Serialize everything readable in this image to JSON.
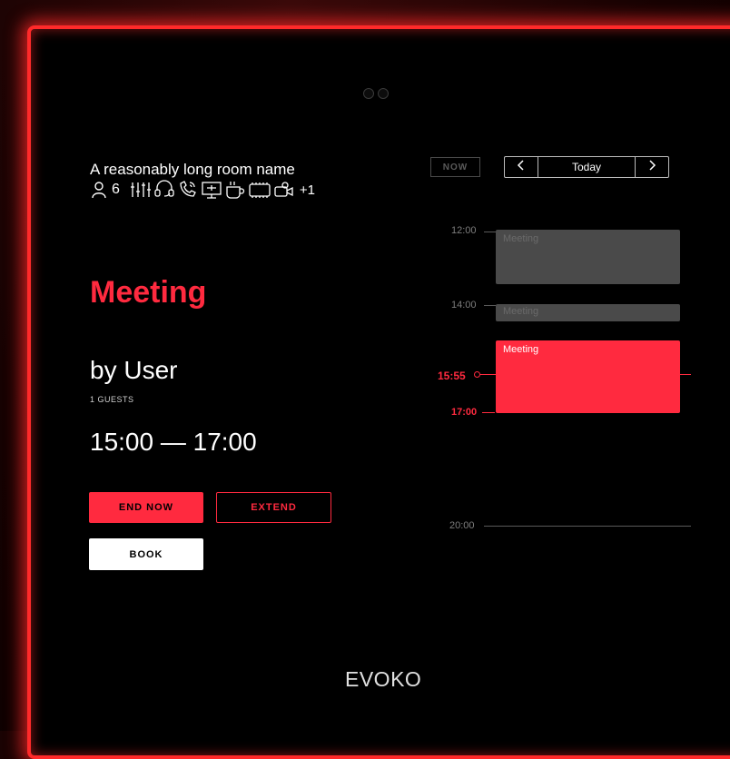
{
  "room": {
    "name": "A reasonably long room name",
    "capacity": "6",
    "more_amenities": "+1",
    "amenity_icons": [
      "person-icon",
      "audio-mixer-icon",
      "headset-icon",
      "phone-icon",
      "display-icon",
      "coffee-icon",
      "projector-icon",
      "video-conference-icon"
    ]
  },
  "meeting": {
    "title": "Meeting",
    "organizer": "by User",
    "guests": "1 GUESTS",
    "time_range": "15:00 — 17:00"
  },
  "actions": {
    "end_now": "END NOW",
    "extend": "EXTEND",
    "book": "BOOK"
  },
  "calendar": {
    "now_button": "NOW",
    "day_label": "Today",
    "hours": [
      "12:00",
      "14:00",
      "20:00"
    ],
    "current_time": "15:55",
    "current_end": "17:00",
    "events": [
      {
        "title": "Meeting",
        "state": "past"
      },
      {
        "title": "Meeting",
        "state": "past"
      },
      {
        "title": "Meeting",
        "state": "current"
      }
    ]
  },
  "brand": {
    "logo": "EVOKO"
  },
  "colors": {
    "accent": "#ff2a3f",
    "frame": "#ff2a2a",
    "past_event": "#4a4a4a"
  }
}
